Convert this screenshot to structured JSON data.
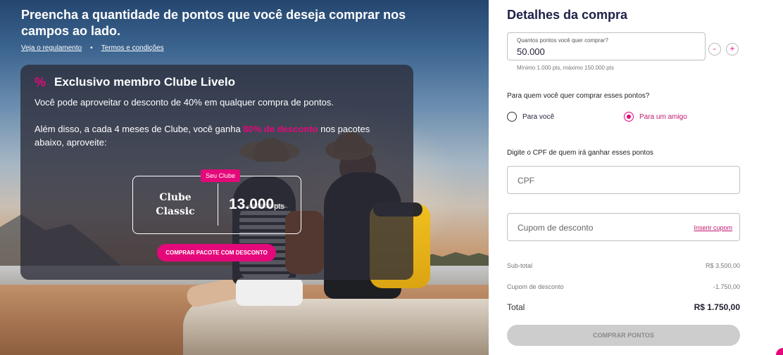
{
  "hero": {
    "title": "Preencha a quantidade de pontos que você deseja comprar nos campos ao lado.",
    "links": [
      "Veja o regulamento",
      "Termos e condições"
    ]
  },
  "club": {
    "title": "Exclusivo membro Clube Livelo",
    "text1": "Você pode aproveitar o desconto de 40% em qualquer compra de pontos.",
    "text2_before": "Além disso, a cada 4 meses de Clube, você ganha ",
    "text2_highlight": "80% de desconto",
    "text2_after": " nos pacotes abaixo, aproveite:",
    "package": {
      "badge": "Seu Clube",
      "name_line1": "Clube",
      "name_line2": "Classic",
      "points": "13.000",
      "unit": "pts"
    },
    "button": "COMPRAR PACOTE COM DESCONTO"
  },
  "panel": {
    "title": "Detalhes da compra",
    "quantity": {
      "label": "Quantos pontos você quer comprar?",
      "value": "50.000",
      "hint": "Mínimo 1.000 pts, máximo 150.000 pts",
      "minus": "-",
      "plus": "+"
    },
    "who": {
      "question": "Para quem você quer comprar esses pontos?",
      "options": [
        "Para você",
        "Para um amigo"
      ],
      "selected": "Para um amigo"
    },
    "cpf": {
      "question": "Digite o CPF de quem irá ganhar esses pontos",
      "placeholder": "CPF"
    },
    "coupon": {
      "placeholder": "Cupom de desconto",
      "link": "Inserir cupom"
    },
    "summary": {
      "subtotal_label": "Sub-total",
      "subtotal_value": "R$ 3.500,00",
      "discount_label": "Cupom de desconto",
      "discount_value": "-1.750,00",
      "total_label": "Total",
      "total_value": "R$ 1.750,00"
    },
    "buy_button": "COMPRAR PONTOS"
  },
  "colors": {
    "accent": "#e5087b",
    "heading": "#1e2048",
    "disabled_button": "#cdcdcd"
  }
}
